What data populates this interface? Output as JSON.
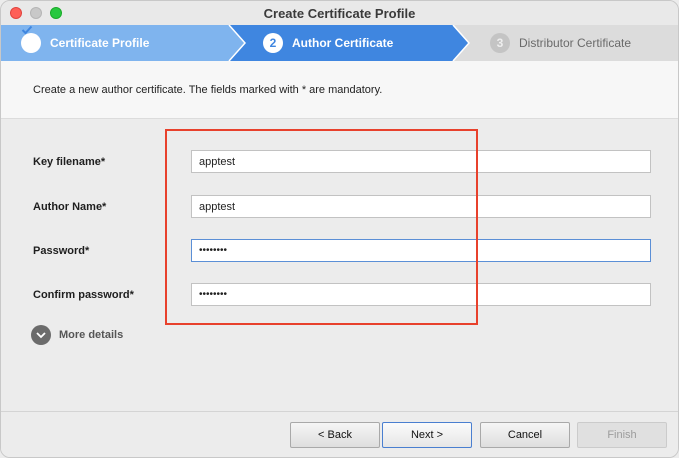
{
  "window": {
    "title": "Create Certificate Profile"
  },
  "steps": [
    {
      "number": "",
      "label": "Certificate Profile",
      "state": "done"
    },
    {
      "number": "2",
      "label": "Author Certificate",
      "state": "active"
    },
    {
      "number": "3",
      "label": "Distributor Certificate",
      "state": "pending"
    }
  ],
  "description": "Create a new author certificate. The fields marked with * are mandatory.",
  "form": {
    "key_filename": {
      "label": "Key filename*",
      "value": "apptest"
    },
    "author_name": {
      "label": "Author Name*",
      "value": "apptest"
    },
    "password": {
      "label": "Password*",
      "value": "••••••••"
    },
    "confirm_password": {
      "label": "Confirm password*",
      "value": "••••••••"
    }
  },
  "more_details": {
    "label": "More details",
    "icon": "chevron-down-icon"
  },
  "buttons": {
    "back": "< Back",
    "next": "Next >",
    "cancel": "Cancel",
    "finish": "Finish"
  },
  "colors": {
    "step_done": "#7fb4ee",
    "step_active": "#3f86e0",
    "step_pending": "#dcdcdc",
    "highlight": "#e8412c"
  }
}
